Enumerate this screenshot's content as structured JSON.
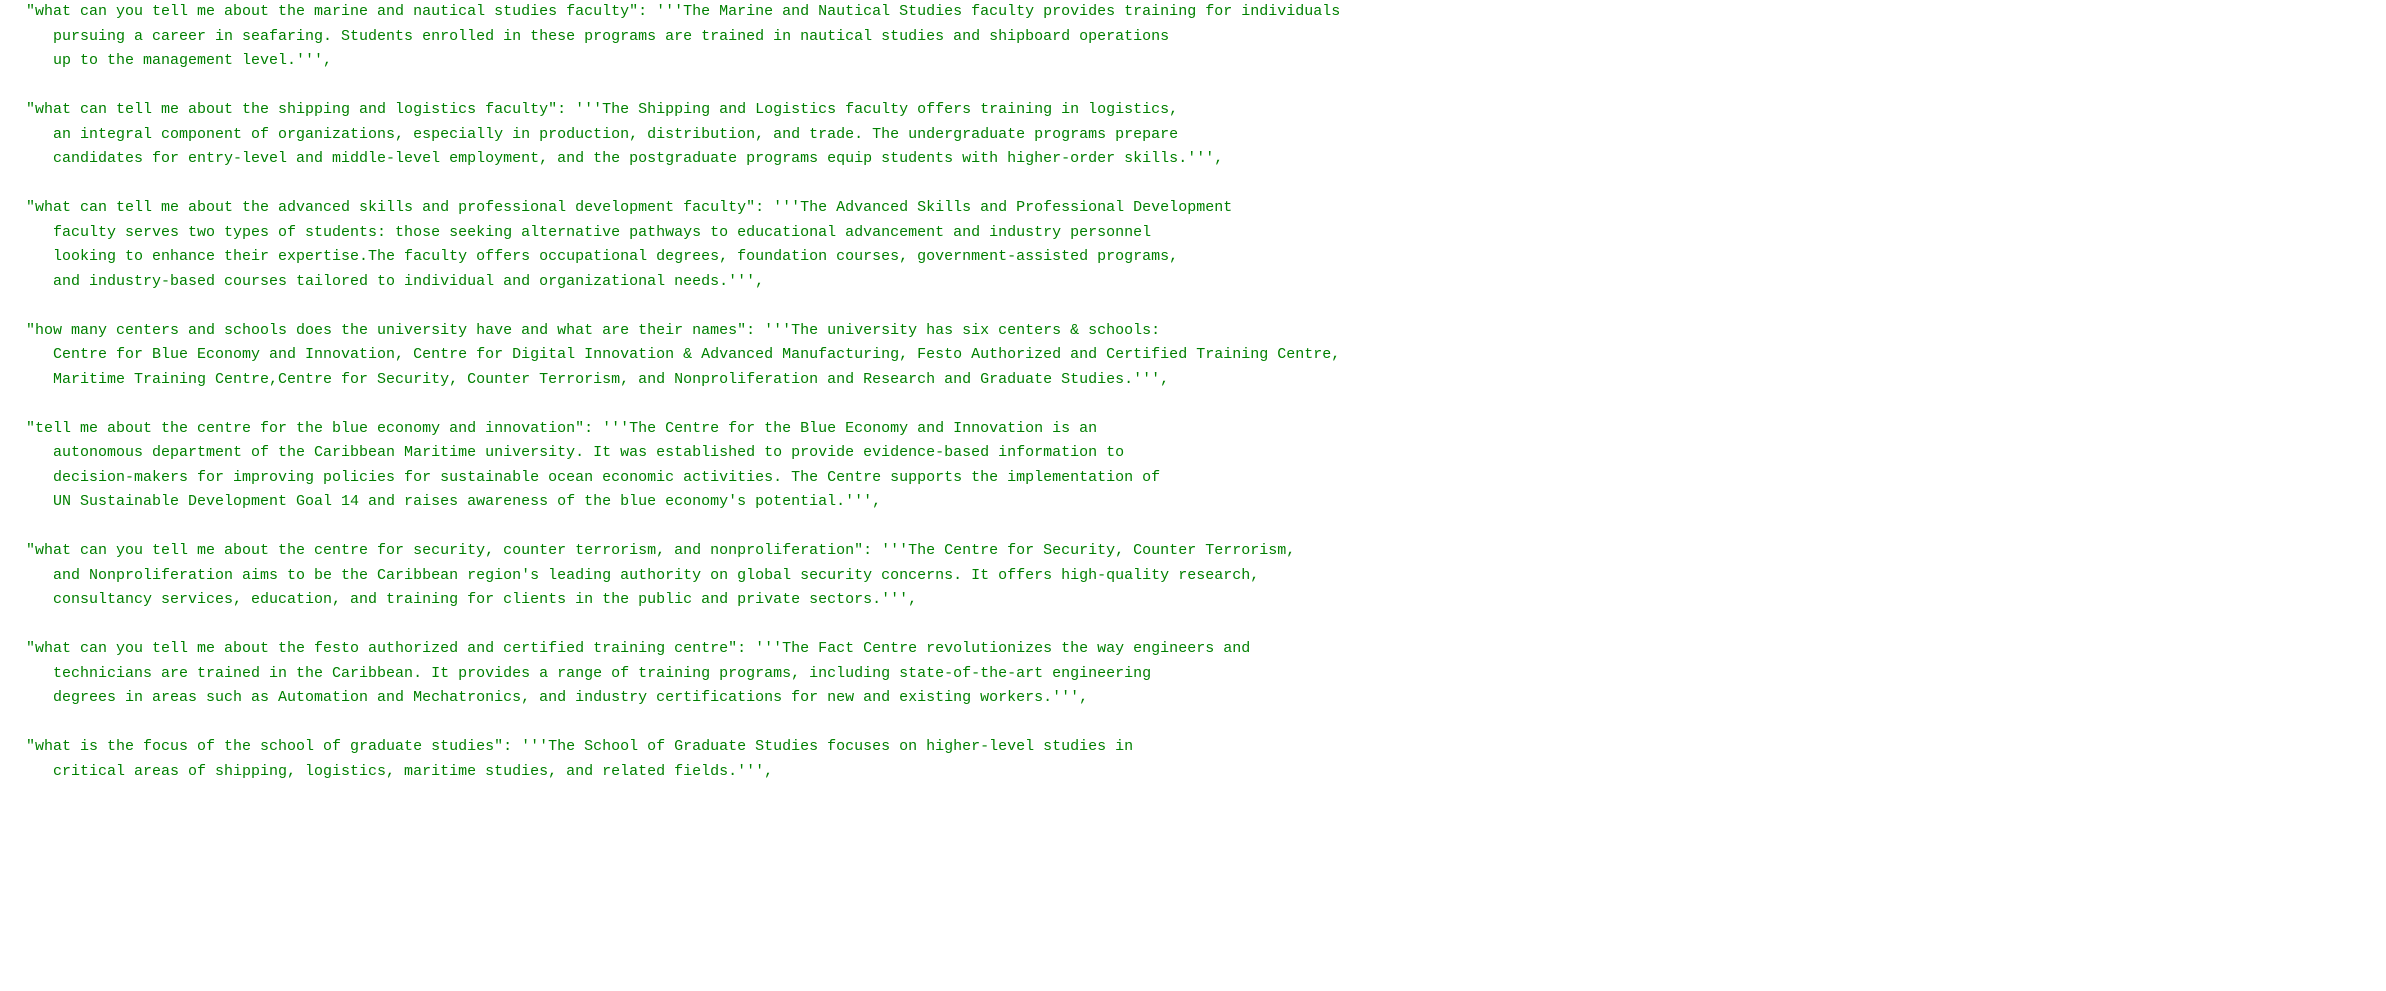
{
  "entries": [
    {
      "key": "\"what can you tell me about the marine and nautical studies faculty\"",
      "value_lines": [
        "'''The Marine and Nautical Studies faculty provides training for individuals",
        "pursuing a career in seafaring. Students enrolled in these programs are trained in nautical studies and shipboard operations",
        "up to the management level.''',"
      ]
    },
    {
      "key": "\"what can tell me about the shipping and logistics faculty\"",
      "value_lines": [
        "'''The Shipping and Logistics faculty offers training in logistics,",
        "an integral component of organizations, especially in production, distribution, and trade. The undergraduate programs prepare",
        "candidates for entry-level and middle-level employment, and the postgraduate programs equip students with higher-order skills.''',"
      ]
    },
    {
      "key": "\"what can tell me about the advanced skills and professional development faculty\"",
      "value_lines": [
        "'''The Advanced Skills and Professional Development",
        "faculty serves two types of students: those seeking alternative pathways to educational advancement and industry personnel",
        "looking to enhance their expertise.The faculty offers occupational degrees, foundation courses, government-assisted programs,",
        "and industry-based courses tailored to individual and organizational needs.''',"
      ]
    },
    {
      "key": "\"how many centers and schools does the university have and what are their names\"",
      "value_lines": [
        "'''The university has six centers & schools:",
        "Centre for Blue Economy and Innovation, Centre for Digital Innovation & Advanced Manufacturing, Festo Authorized and Certified Training Centre,",
        "Maritime Training Centre,Centre for Security, Counter Terrorism, and Nonproliferation and Research and Graduate Studies.''',"
      ]
    },
    {
      "key": "\"tell me about the centre for the blue economy and innovation\"",
      "value_lines": [
        "'''The Centre for the Blue Economy and Innovation is an",
        "autonomous department of the Caribbean Maritime university. It was established to provide evidence-based information to",
        "decision-makers for improving policies for sustainable ocean economic activities. The Centre supports the implementation of",
        "UN Sustainable Development Goal 14 and raises awareness of the blue economy's potential.''',"
      ]
    },
    {
      "key": "\"what can you tell me about the centre for security, counter terrorism, and nonproliferation\"",
      "value_lines": [
        "'''The Centre for Security, Counter Terrorism,",
        "and Nonproliferation aims to be the Caribbean region's leading authority on global security concerns. It offers high-quality research,",
        "consultancy services, education, and training for clients in the public and private sectors.''',"
      ]
    },
    {
      "key": "\"what can you tell me about the festo authorized and certified training centre\"",
      "value_lines": [
        "'''The Fact Centre revolutionizes the way engineers and",
        "technicians are trained in the Caribbean. It provides a range of training programs, including state-of-the-art engineering",
        "degrees in areas such as Automation and Mechatronics, and industry certifications for new and existing workers.''',"
      ]
    },
    {
      "key": "\"what is the focus of the school of graduate studies\"",
      "value_lines": [
        "'''The School of Graduate Studies focuses on higher-level studies in",
        "critical areas of shipping, logistics, maritime studies, and related fields.''',"
      ]
    }
  ],
  "indent": "   ",
  "separator": ": "
}
